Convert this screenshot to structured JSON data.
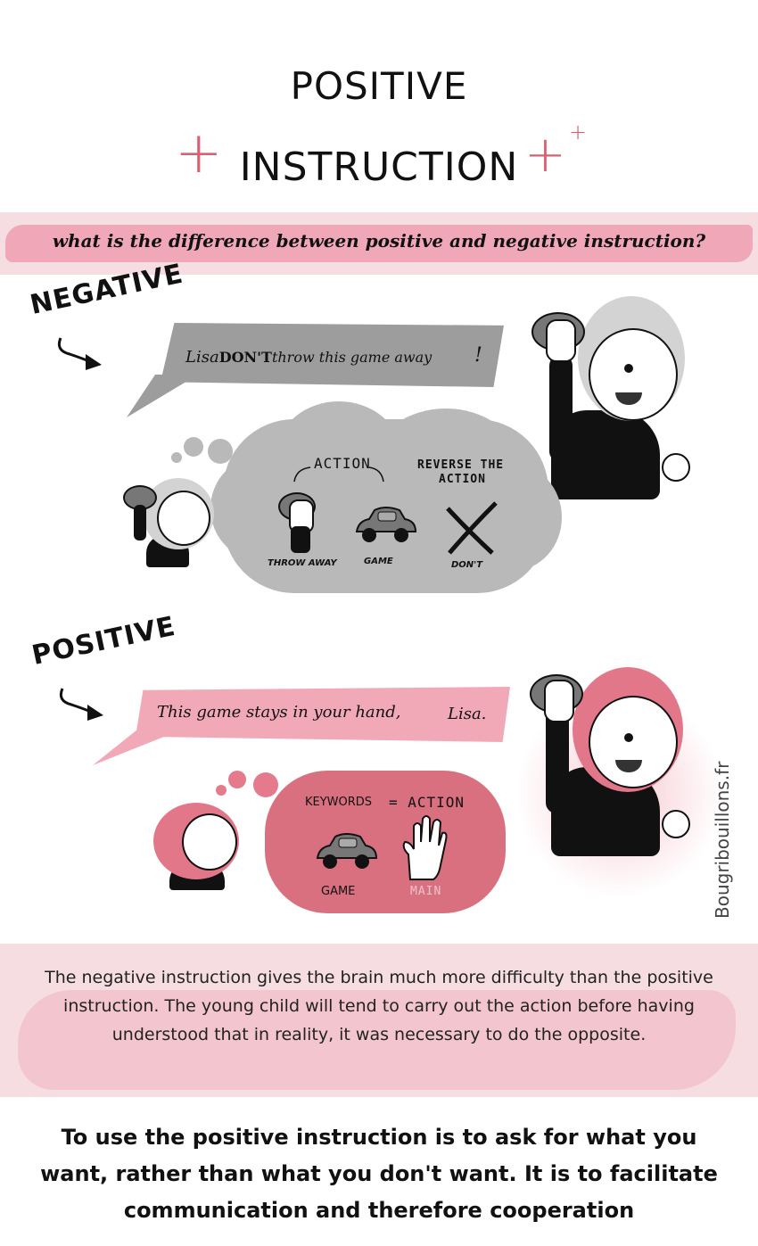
{
  "title": {
    "line1": "POSITIVE",
    "line2": "INSTRUCTION"
  },
  "question": "what is the difference between positive and negative instruction?",
  "negative": {
    "label": "NEGATIVE",
    "speech_pre": "Lisa",
    "speech_emph": "DON'T",
    "speech_post": "throw this game away",
    "speech_end": "!",
    "cloud": {
      "action_label": "ACTION",
      "reverse_line1": "REVERSE THE",
      "reverse_line2": "ACTION",
      "caption_throw": "THROW AWAY",
      "caption_game": "GAME",
      "caption_dont": "DON'T"
    }
  },
  "positive": {
    "label": "POSITIVE",
    "speech_main": "This game stays in your hand,",
    "speech_name": "Lisa.",
    "cloud": {
      "keywords_label": "KEYWORDS",
      "equals_action": "= ACTION",
      "caption_game": "GAME",
      "caption_main": "MAIN"
    }
  },
  "credit": "Bougribouillons.fr",
  "explanation": "The negative instruction gives the brain much more difficulty than the positive instruction. The young child will tend to carry out the action before having understood that in reality, it was necessary to do the opposite.",
  "conclusion": "To use the positive instruction is to ask for what you want, rather than what you don't want. It is to facilitate communication and therefore cooperation",
  "colors": {
    "accent_pink": "#d95f71",
    "band_pink": "#f6dde2",
    "grey_bubble": "#9d9d9d",
    "grey_cloud": "#b9b9b9",
    "pink_cloud": "#d9707f"
  }
}
